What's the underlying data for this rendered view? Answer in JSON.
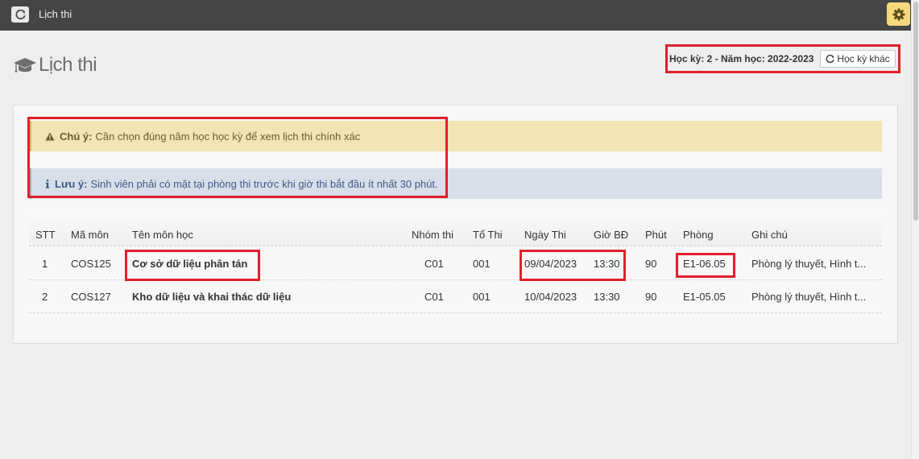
{
  "topbar": {
    "title": "Lịch thi"
  },
  "page": {
    "title": "Lịch thi"
  },
  "term": {
    "label": "Học kỳ: 2 - Năm học: 2022-2023",
    "button_label": "Học kỳ khác"
  },
  "alerts": {
    "warning": {
      "title": "Chú ý:",
      "text": "Cần chọn đúng năm học học kỳ để xem lịch thi chính xác"
    },
    "info": {
      "title": "Lưu ý:",
      "text": "Sinh viên phải có mặt tại phòng thi trước khi giờ thi bắt đầu ít nhất 30 phút."
    }
  },
  "table": {
    "headers": [
      "STT",
      "Mã môn",
      "Tên môn học",
      "Nhóm thi",
      "Tổ Thi",
      "Ngày Thi",
      "Giờ BĐ",
      "Phút",
      "Phòng",
      "Ghi chú"
    ],
    "rows": [
      {
        "stt": "1",
        "code": "COS125",
        "name": "Cơ sở dữ liệu phân tán",
        "group": "C01",
        "team": "001",
        "date": "09/04/2023",
        "time": "13:30",
        "minutes": "90",
        "room": "E1-06.05",
        "note": "Phòng lý thuyết, Hình t..."
      },
      {
        "stt": "2",
        "code": "COS127",
        "name": "Kho dữ liệu và khai thác dữ liệu",
        "group": "C01",
        "team": "001",
        "date": "10/04/2023",
        "time": "13:30",
        "minutes": "90",
        "room": "E1-05.05",
        "note": "Phòng lý thuyết, Hình t..."
      }
    ]
  },
  "colors": {
    "highlight": "#e0202a",
    "topbar": "#454545",
    "warning_bg": "#f2e4b5",
    "info_bg": "#d9dfe9",
    "gear_button": "#f4d97d"
  },
  "icons": [
    "refresh-icon",
    "gear-icon",
    "graduation-cap-icon",
    "refresh-icon",
    "warning-icon",
    "info-icon"
  ]
}
